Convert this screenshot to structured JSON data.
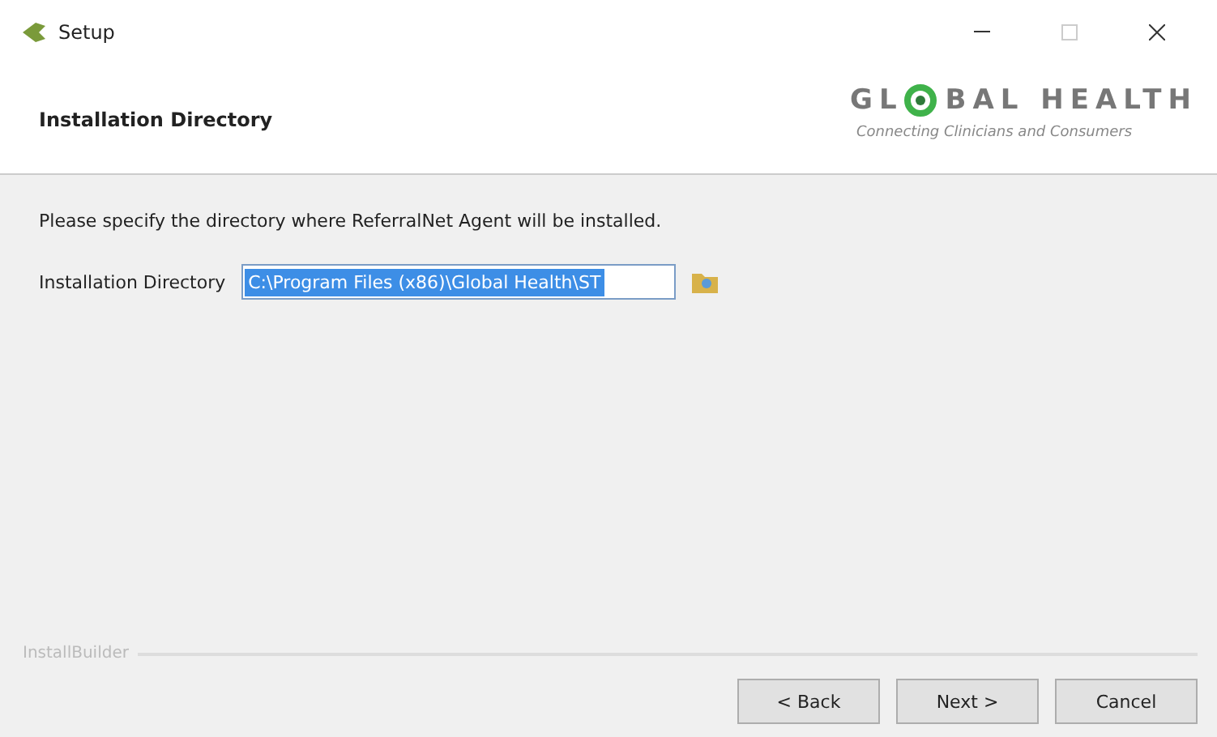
{
  "window": {
    "title": "Setup"
  },
  "header": {
    "title": "Installation Directory",
    "logo": {
      "left": "GL",
      "right": "BAL HEALTH",
      "tagline": "Connecting Clinicians and Consumers"
    }
  },
  "body": {
    "prompt": "Please specify the directory where ReferralNet Agent will be installed.",
    "field": {
      "label": "Installation Directory",
      "value": "C:\\Program Files (x86)\\Global Health\\ST",
      "selected": true
    }
  },
  "footer": {
    "brand": "InstallBuilder",
    "buttons": [
      "< Back",
      "Next >",
      "Cancel"
    ]
  }
}
